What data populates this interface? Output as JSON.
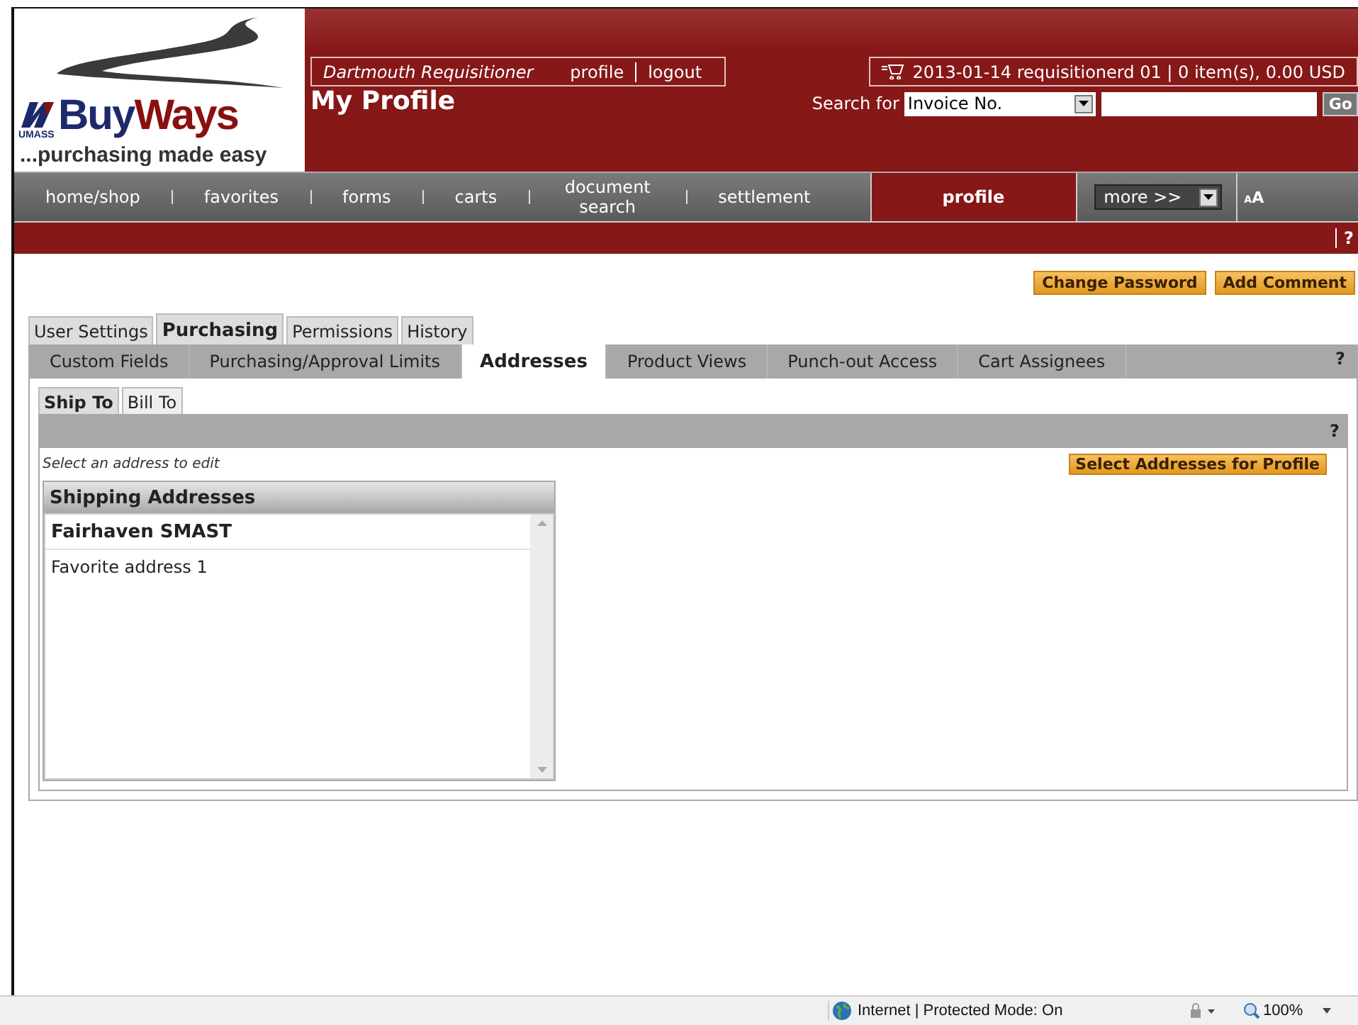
{
  "logo": {
    "brand_first": "Buy",
    "brand_second": "Ways",
    "badge": "UMASS",
    "tagline": "...purchasing made easy"
  },
  "page_title": "My Profile",
  "user_box": {
    "role": "Dartmouth Requisitioner",
    "links": [
      "profile",
      "logout"
    ]
  },
  "cart": {
    "text": "2013-01-14 requisitionerd 01 | 0 item(s), 0.00 USD"
  },
  "search": {
    "label": "Search for",
    "type_value": "Invoice No.",
    "button": "Go"
  },
  "nav": {
    "items": [
      {
        "label": "home/shop",
        "selected": false
      },
      {
        "label": "favorites",
        "selected": false
      },
      {
        "label": "forms",
        "selected": false
      },
      {
        "label": "carts",
        "selected": false
      },
      {
        "label": "document search",
        "selected": false
      },
      {
        "label": "settlement",
        "selected": false
      },
      {
        "label": "profile",
        "selected": true
      }
    ],
    "more": "more >>",
    "font_button": "AA"
  },
  "help_bar": {
    "help": "?"
  },
  "actions": [
    "Change Password",
    "Add Comment"
  ],
  "tabs": [
    {
      "label": "User Settings",
      "selected": false
    },
    {
      "label": "Purchasing",
      "selected": true
    },
    {
      "label": "Permissions",
      "selected": false
    },
    {
      "label": "History",
      "selected": false
    }
  ],
  "subtabs": [
    {
      "label": "Custom Fields",
      "selected": false
    },
    {
      "label": "Purchasing/Approval Limits",
      "selected": false
    },
    {
      "label": "Addresses",
      "selected": true
    },
    {
      "label": "Product Views",
      "selected": false
    },
    {
      "label": "Punch-out Access",
      "selected": false
    },
    {
      "label": "Cart Assignees",
      "selected": false
    }
  ],
  "subtab_help": "?",
  "address_tabs": [
    {
      "label": "Ship To",
      "selected": true
    },
    {
      "label": "Bill To",
      "selected": false
    }
  ],
  "address_bar_help": "?",
  "hint": "Select an address to edit",
  "select_button": "Select Addresses for Profile",
  "address_list": {
    "title": "Shipping Addresses",
    "rows": [
      {
        "label": "Fairhaven SMAST",
        "selected": true
      },
      {
        "label": "Favorite address 1",
        "selected": false
      }
    ]
  },
  "status_bar": {
    "zone": "Internet | Protected Mode: On",
    "zoom": "100%"
  }
}
